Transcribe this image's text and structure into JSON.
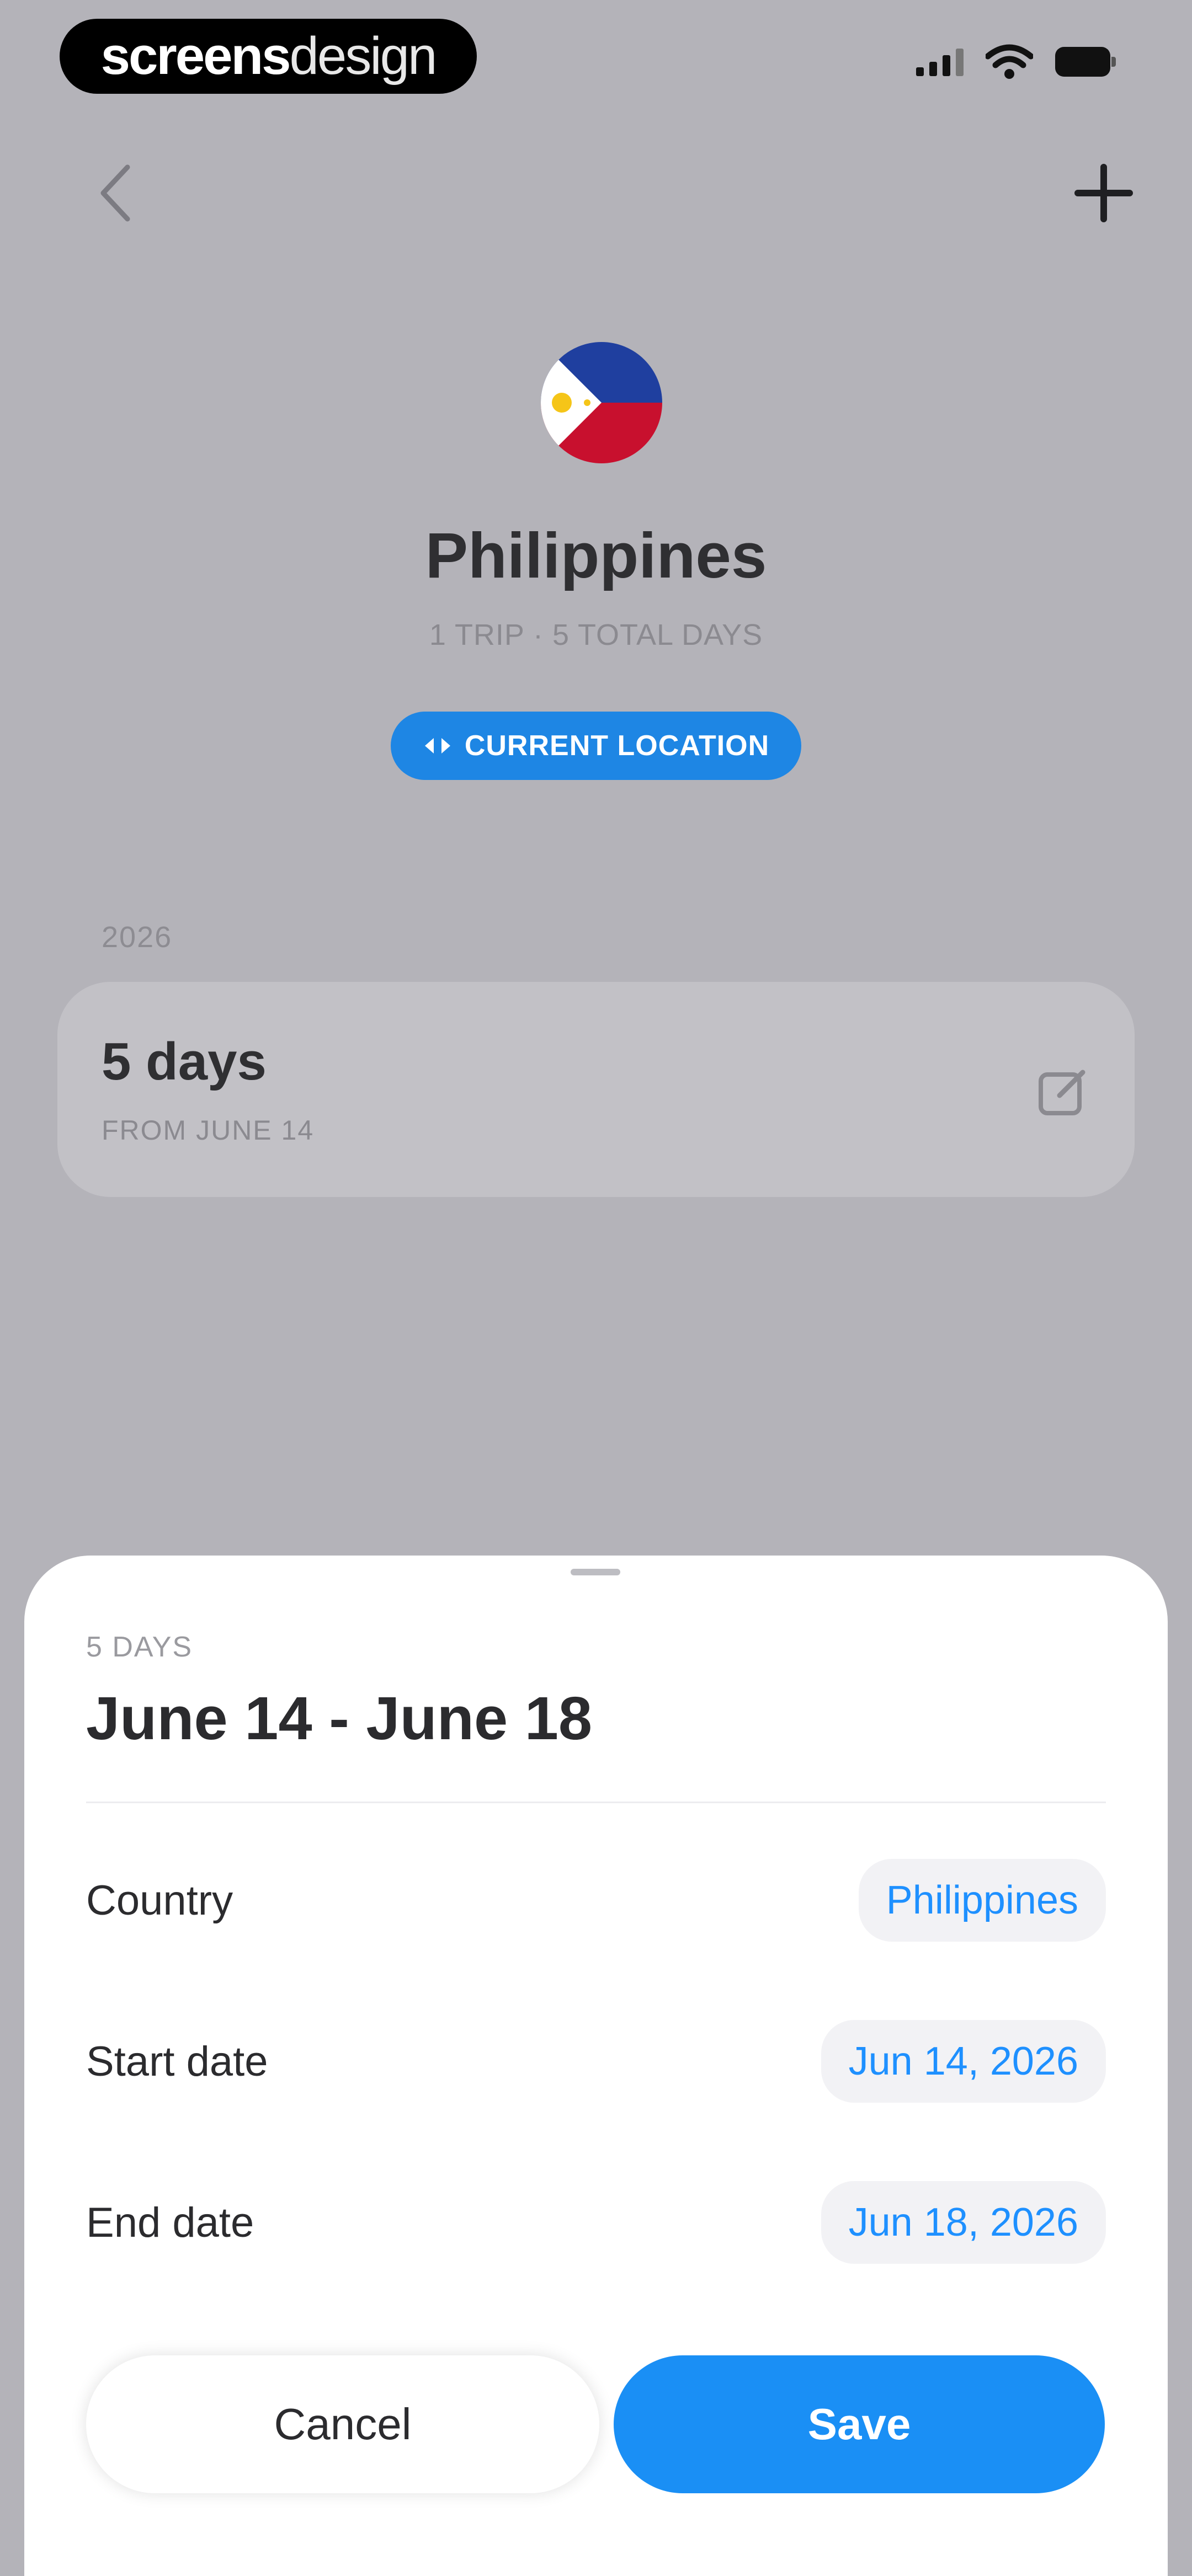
{
  "watermark": {
    "bold": "screens",
    "light": "design"
  },
  "nav": {
    "back_icon": "chevron-left-icon",
    "add_icon": "plus-icon"
  },
  "country": {
    "name": "Philippines",
    "summary": "1 TRIP · 5 TOTAL DAYS",
    "location_badge": "CURRENT LOCATION",
    "flag_colors": {
      "blue": "#1f3f9f",
      "red": "#c8102e",
      "white": "#ffffff",
      "sun": "#f5c518"
    }
  },
  "trips": {
    "year": "2026",
    "items": [
      {
        "duration": "5 days",
        "from": "FROM JUNE 14"
      }
    ]
  },
  "sheet": {
    "days_label": "5 DAYS",
    "date_range": "June 14 - June 18",
    "rows": [
      {
        "label": "Country",
        "value": "Philippines"
      },
      {
        "label": "Start date",
        "value": "Jun 14, 2026"
      },
      {
        "label": "End date",
        "value": "Jun 18, 2026"
      }
    ],
    "cancel_label": "Cancel",
    "save_label": "Save"
  },
  "colors": {
    "accent": "#1a8ff5",
    "background": "#b4b3b9",
    "sheet": "#ffffff"
  }
}
